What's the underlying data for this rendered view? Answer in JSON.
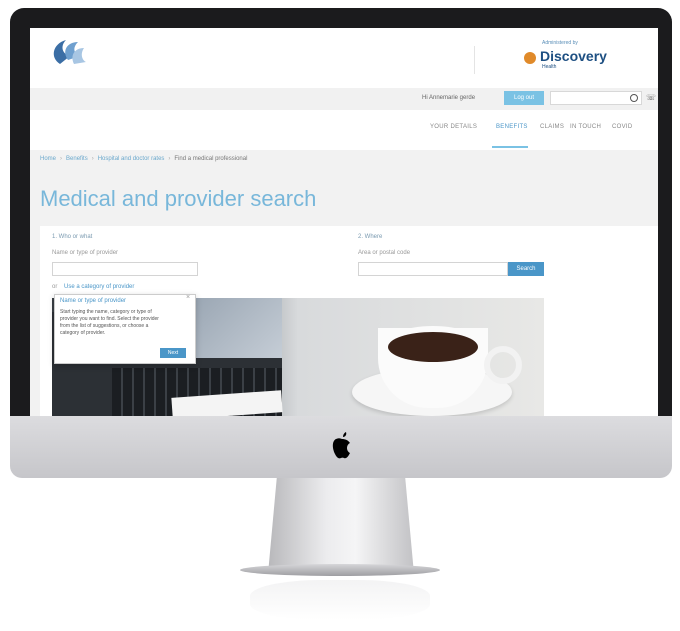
{
  "site": {
    "logo_text": "",
    "partner_label": "Administered by",
    "partner_name": "Discovery",
    "partner_sub": "Health"
  },
  "utility": {
    "username": "Hi Annemarie gerde",
    "logout_label": "Log out",
    "search_placeholder": ""
  },
  "nav": {
    "items": [
      "YOUR DETAILS",
      "BENEFITS",
      "CLAIMS",
      "IN TOUCH",
      "COVID"
    ]
  },
  "breadcrumb": {
    "items": [
      "Home",
      "Benefits",
      "Hospital and doctor rates"
    ],
    "current": "Find a medical professional"
  },
  "page": {
    "title": "Medical and provider search"
  },
  "form": {
    "who_label": "1. Who or what",
    "who_sub": "Name or type of provider",
    "where_label": "2. Where",
    "where_sub": "Area or postal code",
    "search_label": "Search",
    "or_text": "or",
    "category_link": "Use a category of provider"
  },
  "tooltip": {
    "title": "Name or type of provider",
    "body": "Start typing the name, category or type of provider you want to find. Select the provider from the list of suggestions, or choose a category of provider.",
    "next_label": "Next",
    "close_glyph": "×"
  },
  "colors": {
    "accent": "#78b7da",
    "button": "#4a96c8",
    "brand": "#1d4f82"
  }
}
